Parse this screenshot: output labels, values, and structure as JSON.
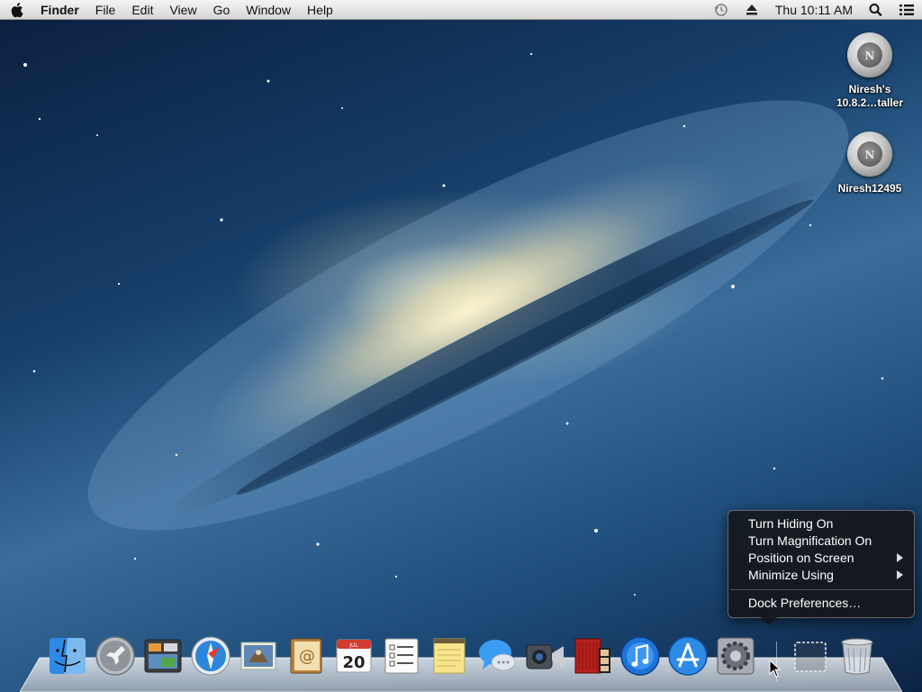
{
  "menubar": {
    "app_name": "Finder",
    "menus": [
      "File",
      "Edit",
      "View",
      "Go",
      "Window",
      "Help"
    ],
    "clock": "Thu 10:11 AM"
  },
  "desktop": {
    "icons": [
      {
        "label_line1": "Niresh's",
        "label_line2": "10.8.2…taller",
        "badge": "N"
      },
      {
        "label_line1": "Niresh12495",
        "label_line2": "",
        "badge": "N"
      }
    ]
  },
  "dock_menu": {
    "items": [
      {
        "label": "Turn Hiding On",
        "submenu": false
      },
      {
        "label": "Turn Magnification On",
        "submenu": false
      },
      {
        "label": "Position on Screen",
        "submenu": true
      },
      {
        "label": "Minimize Using",
        "submenu": true
      }
    ],
    "preferences_label": "Dock Preferences…"
  },
  "dock": {
    "calendar_day": "20",
    "calendar_month": "JUL",
    "icons": [
      "finder-icon",
      "launchpad-icon",
      "mission-control-icon",
      "safari-icon",
      "mail-icon",
      "contacts-icon",
      "calendar-icon",
      "reminders-icon",
      "notes-icon",
      "messages-icon",
      "facetime-icon",
      "photo-booth-icon",
      "itunes-icon",
      "app-store-icon",
      "system-preferences-icon",
      "downloads-stack-icon",
      "trash-icon"
    ]
  },
  "colors": {
    "menubar": "#e6e6e6",
    "menu_background": "#141418",
    "accent_blue": "#1e73d8"
  }
}
